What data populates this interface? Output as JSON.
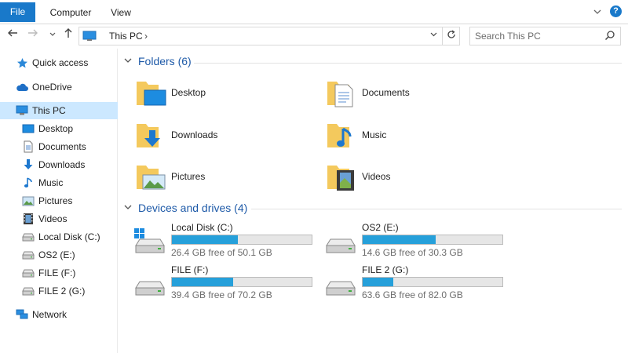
{
  "ribbon": {
    "tabs": [
      "File",
      "Computer",
      "View"
    ],
    "help": "?"
  },
  "address": {
    "crumb": "This PC",
    "separator": "›"
  },
  "search": {
    "placeholder": "Search This PC"
  },
  "sidebar": {
    "items": [
      {
        "label": "Quick access",
        "icon": "star-icon"
      },
      {
        "label": "OneDrive",
        "icon": "cloud-icon"
      },
      {
        "label": "This PC",
        "icon": "computer-icon"
      },
      {
        "label": "Desktop",
        "icon": "desktop-icon"
      },
      {
        "label": "Documents",
        "icon": "documents-icon"
      },
      {
        "label": "Downloads",
        "icon": "download-icon"
      },
      {
        "label": "Music",
        "icon": "music-icon"
      },
      {
        "label": "Pictures",
        "icon": "pictures-icon"
      },
      {
        "label": "Videos",
        "icon": "videos-icon"
      },
      {
        "label": "Local Disk (C:)",
        "icon": "drive-icon"
      },
      {
        "label": "OS2 (E:)",
        "icon": "drive-icon"
      },
      {
        "label": "FILE (F:)",
        "icon": "drive-icon"
      },
      {
        "label": "FILE 2 (G:)",
        "icon": "drive-icon"
      },
      {
        "label": "Network",
        "icon": "network-icon"
      }
    ]
  },
  "folders": {
    "title": "Folders (6)",
    "items": [
      {
        "label": "Desktop",
        "icon": "desktop-folder-icon"
      },
      {
        "label": "Documents",
        "icon": "documents-folder-icon"
      },
      {
        "label": "Downloads",
        "icon": "downloads-folder-icon"
      },
      {
        "label": "Music",
        "icon": "music-folder-icon"
      },
      {
        "label": "Pictures",
        "icon": "pictures-folder-icon"
      },
      {
        "label": "Videos",
        "icon": "videos-folder-icon"
      }
    ]
  },
  "drives": {
    "title": "Devices and drives (4)",
    "items": [
      {
        "name": "Local Disk (C:)",
        "free": "26.4 GB free of 50.1 GB",
        "used_fraction": 0.47
      },
      {
        "name": "OS2 (E:)",
        "free": "14.6 GB free of 30.3 GB",
        "used_fraction": 0.52
      },
      {
        "name": "FILE (F:)",
        "free": "39.4 GB free of 70.2 GB",
        "used_fraction": 0.44
      },
      {
        "name": "FILE 2 (G:)",
        "free": "63.6 GB free of 82.0 GB",
        "used_fraction": 0.22
      }
    ]
  },
  "colors": {
    "accent": "#1979ca",
    "selection": "#cce8ff",
    "bar_fill": "#26a0da",
    "group_title": "#1e5aa8",
    "folder": "#f4c95d"
  }
}
